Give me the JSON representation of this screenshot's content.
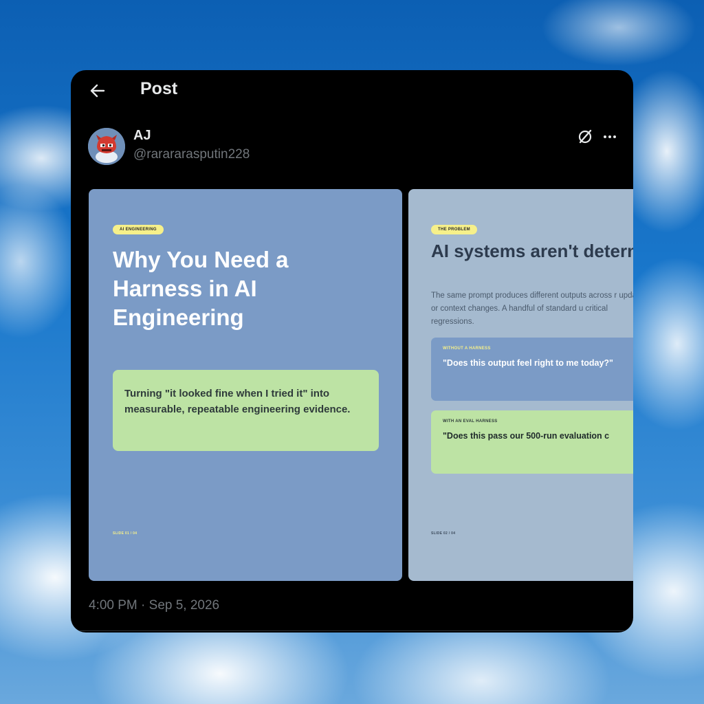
{
  "header": {
    "title": "Post"
  },
  "author": {
    "name": "AJ",
    "handle": "@rarararasputin228"
  },
  "slides": [
    {
      "tag": "AI ENGINEERING",
      "title": "Why You Need a Harness in AI Engineering",
      "callout": "Turning \"it looked fine when I tried it\" into measurable, repeatable engineering evidence.",
      "counter": "SLIDE 01 / 04",
      "background": "#7b9bc6",
      "callout_color": "#bde3a4",
      "tag_color": "#f6f08a"
    },
    {
      "tag": "THE PROBLEM",
      "title": "AI systems aren't deterministic.",
      "body": "The same prompt produces different outputs across r updates, or context changes. A handful of standard u critical regressions.",
      "boxes": [
        {
          "label": "WITHOUT A HARNESS",
          "quote": "\"Does this output feel right to me today?\"",
          "color": "#7b9bc6"
        },
        {
          "label": "WITH AN EVAL HARNESS",
          "quote": "\"Does this pass our 500-run evaluation c",
          "color": "#bde3a4"
        }
      ],
      "counter": "SLIDE 02 / 04",
      "background": "#a5bacf"
    }
  ],
  "timestamp": "4:00 PM · Sep 5, 2026",
  "icons": {
    "back": "arrow-left",
    "grok": "grok-slash-circle",
    "more": "ellipsis",
    "avatar": "red-character-avatar"
  }
}
